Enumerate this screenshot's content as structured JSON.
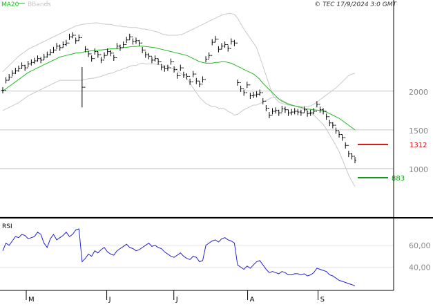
{
  "header": {
    "legend_ma": "MA20",
    "legend_bb": "BBands",
    "copyright": "© TEC 17/9/2024 3:0 GMT"
  },
  "colors": {
    "ma": "#22bb22",
    "bands": "#c8c8c8",
    "price": "#000000",
    "rsi": "#2222cc",
    "resistance": "#cc1111",
    "support": "#119911",
    "grid": "#c8c8c8",
    "axis_text": "#888888"
  },
  "chart_data": [
    {
      "type": "ohlc",
      "title": "",
      "x_labels": [
        {
          "label": "M",
          "x": 7
        },
        {
          "label": "J",
          "x": 31
        },
        {
          "label": "J",
          "x": 51
        },
        {
          "label": "A",
          "x": 73
        },
        {
          "label": "S",
          "x": 94
        }
      ],
      "x_range": [
        0,
        105
      ],
      "y_ticks": [
        1000,
        1500,
        2000
      ],
      "y_tick_labels": [
        "1000",
        "1500",
        "2000"
      ],
      "ylim": [
        500,
        3050
      ],
      "grid": true,
      "levels": [
        {
          "label": "1312",
          "value": 1312,
          "kind": "resistance"
        },
        {
          "label": "883",
          "value": 883,
          "kind": "support"
        }
      ],
      "close": [
        2010,
        2140,
        2180,
        2230,
        2260,
        2290,
        2330,
        2300,
        2350,
        2370,
        2390,
        2420,
        2400,
        2440,
        2470,
        2500,
        2530,
        2580,
        2560,
        2600,
        2620,
        2700,
        2720,
        2650,
        2690,
        2050,
        2540,
        2480,
        2420,
        2510,
        2470,
        2400,
        2460,
        2510,
        2490,
        2430,
        2580,
        2560,
        2600,
        2660,
        2700,
        2640,
        2650,
        2620,
        2530,
        2470,
        2450,
        2400,
        2420,
        2380,
        2310,
        2290,
        2300,
        2380,
        2280,
        2200,
        2300,
        2210,
        2190,
        2120,
        2220,
        2130,
        2090,
        2150,
        2410,
        2460,
        2630,
        2670,
        2540,
        2580,
        2600,
        2550,
        2640,
        2620,
        2110,
        2030,
        1980,
        2080,
        1940,
        1950,
        1960,
        1980,
        1870,
        1780,
        1690,
        1740,
        1750,
        1720,
        1770,
        1760,
        1720,
        1730,
        1740,
        1730,
        1720,
        1760,
        1710,
        1720,
        1740,
        1830,
        1760,
        1740,
        1670,
        1590,
        1560,
        1490,
        1440,
        1400,
        1300,
        1190,
        1160,
        1110
      ],
      "high_low_spread": [
        40,
        40,
        40,
        40,
        40,
        40,
        40,
        40,
        40,
        40,
        40,
        40,
        40,
        40,
        40,
        40,
        40,
        40,
        40,
        40,
        40,
        40,
        40,
        40,
        40,
        260,
        40,
        40,
        40,
        40,
        40,
        40,
        40,
        40,
        40,
        40,
        40,
        40,
        40,
        40,
        40,
        40,
        40,
        40,
        40,
        40,
        40,
        40,
        40,
        40,
        40,
        40,
        40,
        40,
        40,
        40,
        40,
        40,
        40,
        40,
        40,
        40,
        40,
        40,
        40,
        40,
        40,
        40,
        40,
        40,
        40,
        40,
        40,
        40,
        40,
        40,
        40,
        40,
        40,
        40,
        40,
        40,
        40,
        40,
        40,
        40,
        40,
        40,
        40,
        40,
        40,
        40,
        40,
        40,
        40,
        40,
        40,
        40,
        40,
        40,
        40,
        40,
        40,
        40,
        40,
        40,
        40,
        40,
        40,
        40,
        40,
        40
      ],
      "series": [
        {
          "name": "MA20",
          "kind": "ma",
          "values": [
            2000,
            2030,
            2060,
            2090,
            2120,
            2150,
            2180,
            2210,
            2240,
            2260,
            2280,
            2300,
            2320,
            2340,
            2360,
            2380,
            2400,
            2420,
            2440,
            2450,
            2460,
            2470,
            2480,
            2490,
            2495,
            2500,
            2510,
            2515,
            2520,
            2525,
            2530,
            2530,
            2535,
            2540,
            2545,
            2545,
            2550,
            2555,
            2560,
            2565,
            2570,
            2575,
            2575,
            2580,
            2580,
            2575,
            2570,
            2565,
            2560,
            2550,
            2540,
            2530,
            2520,
            2510,
            2500,
            2490,
            2480,
            2470,
            2460,
            2440,
            2420,
            2400,
            2380,
            2370,
            2360,
            2360,
            2360,
            2370,
            2370,
            2380,
            2380,
            2370,
            2360,
            2340,
            2320,
            2300,
            2280,
            2260,
            2240,
            2220,
            2190,
            2150,
            2100,
            2060,
            2020,
            1980,
            1940,
            1900,
            1870,
            1850,
            1830,
            1820,
            1810,
            1800,
            1790,
            1780,
            1770,
            1765,
            1760,
            1755,
            1750,
            1745,
            1730,
            1710,
            1690,
            1670,
            1650,
            1620,
            1590,
            1560,
            1530,
            1500
          ]
        },
        {
          "name": "BB upper",
          "kind": "band",
          "values": [
            2250,
            2290,
            2330,
            2370,
            2410,
            2450,
            2480,
            2510,
            2540,
            2560,
            2580,
            2600,
            2620,
            2640,
            2660,
            2680,
            2700,
            2720,
            2740,
            2760,
            2780,
            2800,
            2820,
            2840,
            2850,
            2860,
            2865,
            2870,
            2875,
            2880,
            2880,
            2870,
            2865,
            2860,
            2860,
            2850,
            2840,
            2840,
            2830,
            2830,
            2820,
            2820,
            2820,
            2810,
            2800,
            2800,
            2790,
            2780,
            2770,
            2760,
            2740,
            2730,
            2720,
            2720,
            2720,
            2720,
            2730,
            2740,
            2760,
            2780,
            2800,
            2820,
            2840,
            2860,
            2880,
            2900,
            2920,
            2940,
            2960,
            2980,
            2990,
            3000,
            3000,
            2990,
            2940,
            2870,
            2800,
            2740,
            2680,
            2620,
            2560,
            2440,
            2320,
            2200,
            2080,
            1960,
            1900,
            1860,
            1840,
            1830,
            1820,
            1815,
            1810,
            1805,
            1800,
            1800,
            1800,
            1810,
            1830,
            1860,
            1890,
            1920,
            1950,
            1980,
            2010,
            2040,
            2080,
            2120,
            2160,
            2200,
            2220,
            2230
          ]
        },
        {
          "name": "BB lower",
          "kind": "band",
          "values": [
            1750,
            1770,
            1790,
            1810,
            1830,
            1850,
            1880,
            1910,
            1940,
            1960,
            1980,
            2000,
            2020,
            2040,
            2060,
            2080,
            2100,
            2120,
            2140,
            2140,
            2140,
            2140,
            2140,
            2140,
            2140,
            2140,
            2150,
            2160,
            2165,
            2170,
            2180,
            2190,
            2205,
            2220,
            2230,
            2240,
            2260,
            2270,
            2290,
            2300,
            2320,
            2330,
            2330,
            2350,
            2360,
            2350,
            2350,
            2350,
            2350,
            2340,
            2340,
            2330,
            2320,
            2300,
            2280,
            2260,
            2230,
            2200,
            2160,
            2100,
            2040,
            1980,
            1920,
            1880,
            1840,
            1820,
            1800,
            1800,
            1780,
            1780,
            1770,
            1740,
            1720,
            1690,
            1700,
            1730,
            1760,
            1780,
            1800,
            1820,
            1820,
            1840,
            1860,
            1880,
            1900,
            1920,
            1920,
            1900,
            1880,
            1860,
            1840,
            1825,
            1810,
            1795,
            1780,
            1760,
            1740,
            1720,
            1690,
            1650,
            1610,
            1570,
            1510,
            1440,
            1370,
            1300,
            1220,
            1120,
            1020,
            920,
            840,
            770
          ]
        }
      ]
    },
    {
      "type": "line",
      "title": "RSI",
      "ylim": [
        20,
        82
      ],
      "y_ticks": [
        40,
        60
      ],
      "y_tick_labels": [
        "40,00",
        "60,00"
      ],
      "series": [
        {
          "name": "RSI",
          "kind": "rsi",
          "values": [
            55,
            62,
            60,
            64,
            68,
            67,
            70,
            69,
            66,
            67,
            68,
            72,
            70,
            62,
            58,
            66,
            70,
            65,
            67,
            69,
            72,
            68,
            70,
            74,
            75,
            45,
            48,
            52,
            50,
            55,
            53,
            56,
            58,
            54,
            52,
            51,
            55,
            57,
            59,
            61,
            58,
            57,
            55,
            56,
            58,
            60,
            62,
            59,
            60,
            58,
            57,
            54,
            52,
            50,
            49,
            51,
            53,
            50,
            48,
            47,
            50,
            49,
            45,
            46,
            60,
            62,
            64,
            65,
            63,
            66,
            67,
            65,
            64,
            62,
            42,
            40,
            38,
            41,
            39,
            42,
            45,
            46,
            42,
            38,
            35,
            36,
            35,
            34,
            36,
            35,
            33,
            33,
            34,
            34,
            33,
            34,
            32,
            33,
            35,
            39,
            38,
            37,
            36,
            33,
            32,
            30,
            28,
            27,
            26,
            25,
            24,
            23
          ]
        }
      ]
    }
  ]
}
